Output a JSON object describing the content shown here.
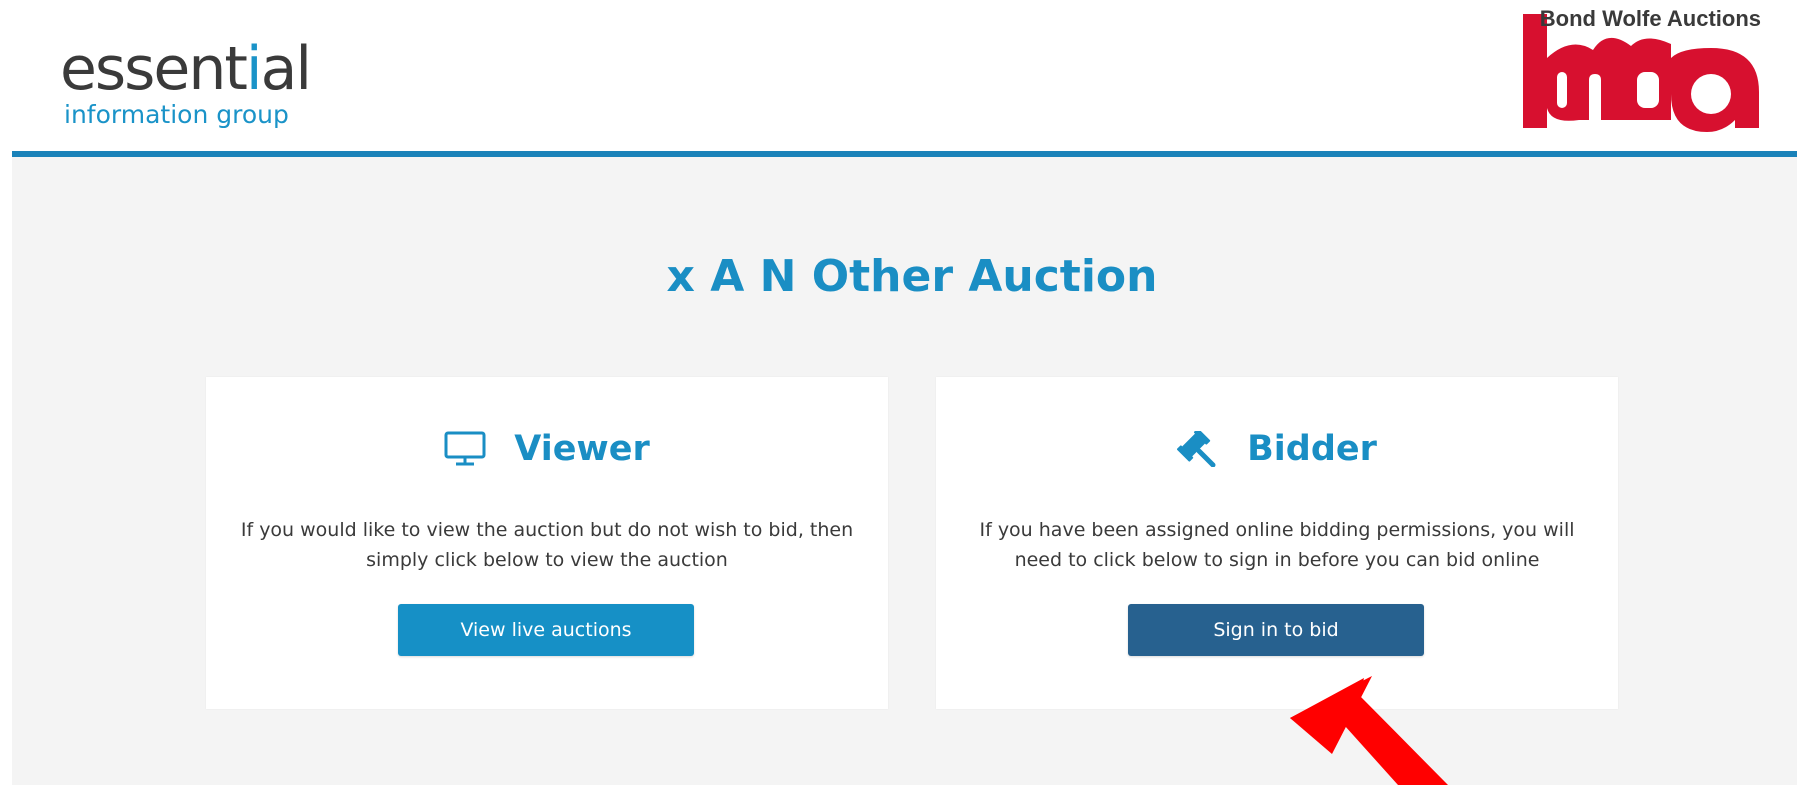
{
  "header": {
    "brand": {
      "word_start": "essent",
      "word_accent": "i",
      "word_end": "al",
      "subtitle": "information group"
    },
    "auction_logo": {
      "name": "Bond Wolfe Auctions",
      "mark_color": "#d7102f"
    },
    "rule_color": "#1a82b9"
  },
  "main": {
    "title": "x A N Other Auction",
    "cards": {
      "viewer": {
        "icon": "monitor-icon",
        "heading": "Viewer",
        "text": "If you would like to view the auction but do not wish to bid, then simply click below to view the auction",
        "button_label": "View live auctions",
        "button_color": "#1690c6"
      },
      "bidder": {
        "icon": "gavel-icon",
        "heading": "Bidder",
        "text": "If you have been assigned online bidding permissions, you will need to click below to sign in before you can bid online",
        "button_label": "Sign in to bid",
        "button_color": "#27618f"
      }
    },
    "annotation": {
      "icon": "red-arrow-icon",
      "color": "#ff0000"
    }
  },
  "colors": {
    "accent": "#1a8ec4",
    "background": "#f4f4f4"
  }
}
